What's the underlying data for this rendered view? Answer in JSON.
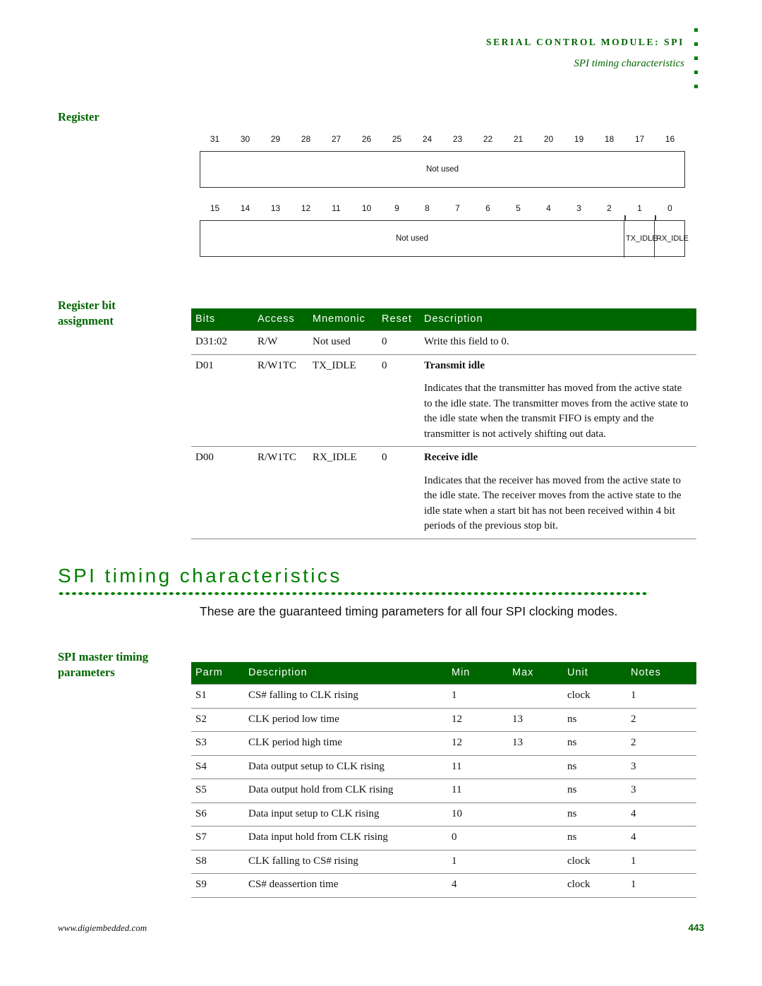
{
  "header": {
    "module_title": "SERIAL CONTROL MODULE: SPI",
    "subtitle": "SPI timing characteristics"
  },
  "register_section": {
    "label": "Register",
    "rows": [
      {
        "bit_numbers": [
          "31",
          "30",
          "29",
          "28",
          "27",
          "26",
          "25",
          "24",
          "23",
          "22",
          "21",
          "20",
          "19",
          "18",
          "17",
          "16"
        ],
        "fields": [
          {
            "name": "Not used",
            "span": 16
          }
        ]
      },
      {
        "bit_numbers": [
          "15",
          "14",
          "13",
          "12",
          "11",
          "10",
          "9",
          "8",
          "7",
          "6",
          "5",
          "4",
          "3",
          "2",
          "1",
          "0"
        ],
        "fields": [
          {
            "name": "Not used",
            "span": 14
          },
          {
            "name": "TX_IDLE",
            "span": 1
          },
          {
            "name": "RX_IDLE",
            "span": 1
          }
        ]
      }
    ]
  },
  "bit_assignment": {
    "label_line1": "Register bit",
    "label_line2": "assignment",
    "columns": [
      "Bits",
      "Access",
      "Mnemonic",
      "Reset",
      "Description"
    ],
    "rows": [
      {
        "bits": "D31:02",
        "access": "R/W",
        "mnemonic": "Not used",
        "reset": "0",
        "description": "Write this field to 0.",
        "detail": ""
      },
      {
        "bits": "D01",
        "access": "R/W1TC",
        "mnemonic": "TX_IDLE",
        "reset": "0",
        "description": "Transmit idle",
        "detail": "Indicates that the transmitter has moved from the active state to the idle state. The transmitter moves from the active state to the idle state when the transmit FIFO is empty and the transmitter is not actively shifting out data."
      },
      {
        "bits": "D00",
        "access": "R/W1TC",
        "mnemonic": "RX_IDLE",
        "reset": "0",
        "description": "Receive idle",
        "detail": "Indicates that the receiver has moved from the active state to the idle state. The receiver moves from the active state to the idle state when a start bit has not been received within 4 bit periods of the previous stop bit."
      }
    ]
  },
  "timing_section": {
    "heading": "SPI timing characteristics",
    "intro": "These are the guaranteed timing parameters for all four SPI clocking modes."
  },
  "master_timing": {
    "label_line1": "SPI master timing",
    "label_line2": "parameters",
    "columns": [
      "Parm",
      "Description",
      "Min",
      "Max",
      "Unit",
      "Notes"
    ],
    "rows": [
      {
        "parm": "S1",
        "description": "CS# falling to CLK rising",
        "min": "1",
        "max": "",
        "unit": "clock",
        "notes": "1"
      },
      {
        "parm": "S2",
        "description": "CLK period low time",
        "min": "12",
        "max": "13",
        "unit": "ns",
        "notes": "2"
      },
      {
        "parm": "S3",
        "description": "CLK period high time",
        "min": "12",
        "max": "13",
        "unit": "ns",
        "notes": "2"
      },
      {
        "parm": "S4",
        "description": "Data output setup to CLK rising",
        "min": "11",
        "max": "",
        "unit": "ns",
        "notes": "3"
      },
      {
        "parm": "S5",
        "description": "Data output hold from CLK rising",
        "min": "11",
        "max": "",
        "unit": "ns",
        "notes": "3"
      },
      {
        "parm": "S6",
        "description": "Data input setup to CLK rising",
        "min": "10",
        "max": "",
        "unit": "ns",
        "notes": "4"
      },
      {
        "parm": "S7",
        "description": "Data input hold from CLK rising",
        "min": "0",
        "max": "",
        "unit": "ns",
        "notes": "4"
      },
      {
        "parm": "S8",
        "description": "CLK falling to CS# rising",
        "min": "1",
        "max": "",
        "unit": "clock",
        "notes": "1"
      },
      {
        "parm": "S9",
        "description": "CS# deassertion time",
        "min": "4",
        "max": "",
        "unit": "clock",
        "notes": "1"
      }
    ]
  },
  "footer": {
    "url": "www.digiembedded.com",
    "page_number": "443"
  },
  "colors": {
    "brand_green": "#006600",
    "accent_green": "#008000"
  }
}
